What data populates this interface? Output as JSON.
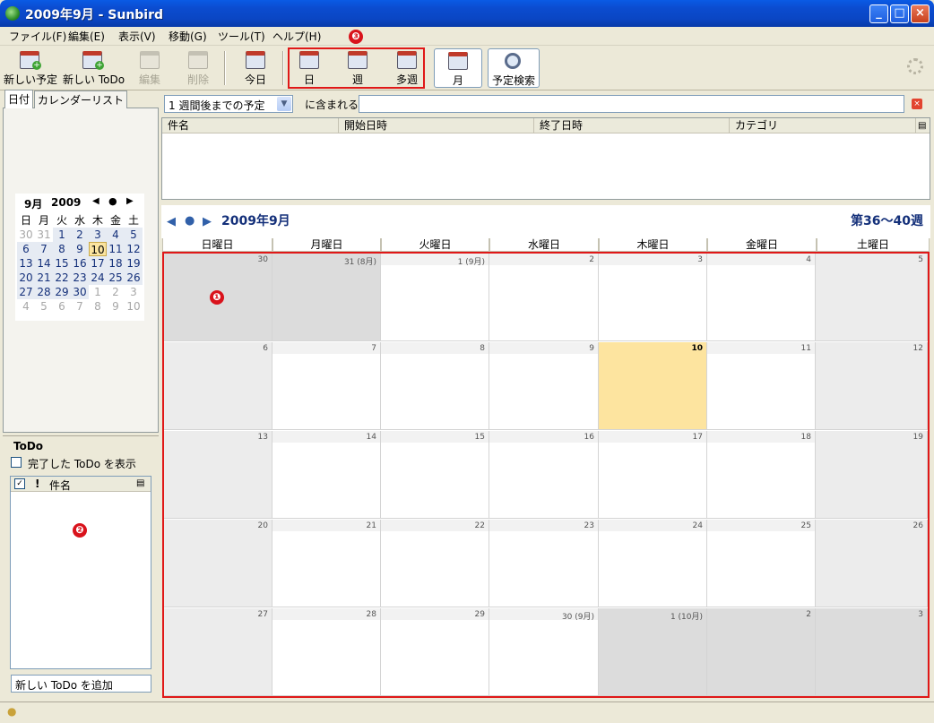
{
  "window": {
    "title": "2009年9月 - Sunbird"
  },
  "menu": [
    "ファイル(F)",
    "編集(E)",
    "表示(V)",
    "移動(G)",
    "ツール(T)",
    "ヘルプ(H)"
  ],
  "toolbar": {
    "new_event": "新しい予定",
    "new_todo": "新しい ToDo",
    "edit": "編集",
    "delete": "削除",
    "today": "今日",
    "day": "日",
    "week": "週",
    "multiweek": "多週",
    "month": "月",
    "search": "予定検索"
  },
  "left": {
    "tab_date": "日付",
    "tab_calendars": "カレンダーリスト",
    "minical": {
      "month": "9月",
      "year": "2009",
      "weekdays": [
        "日",
        "月",
        "火",
        "水",
        "木",
        "金",
        "土"
      ],
      "weeks": [
        [
          "30",
          "31",
          "1",
          "2",
          "3",
          "4",
          "5"
        ],
        [
          "6",
          "7",
          "8",
          "9",
          "10",
          "11",
          "12"
        ],
        [
          "13",
          "14",
          "15",
          "16",
          "17",
          "18",
          "19"
        ],
        [
          "20",
          "21",
          "22",
          "23",
          "24",
          "25",
          "26"
        ],
        [
          "27",
          "28",
          "29",
          "30",
          "1",
          "2",
          "3"
        ],
        [
          "4",
          "5",
          "6",
          "7",
          "8",
          "9",
          "10"
        ]
      ],
      "today": "10"
    },
    "todo": {
      "title": "ToDo",
      "show_completed": "完了した ToDo を表示",
      "col_name": "件名",
      "col_priority": "!",
      "add_placeholder": "新しい ToDo を追加"
    }
  },
  "filter": {
    "select_value": "1 週間後までの予定",
    "contains": "に含まれる"
  },
  "event_list": {
    "columns": [
      "件名",
      "開始日時",
      "終了日時",
      "カテゴリ"
    ]
  },
  "calendar": {
    "month_title": "2009年9月",
    "week_range": "第36〜40週",
    "day_names": [
      "日曜日",
      "月曜日",
      "火曜日",
      "水曜日",
      "木曜日",
      "金曜日",
      "土曜日"
    ],
    "weeks": [
      [
        "30",
        "31 (8月)",
        "1 (9月)",
        "2",
        "3",
        "4",
        "5"
      ],
      [
        "6",
        "7",
        "8",
        "9",
        "10",
        "11",
        "12"
      ],
      [
        "13",
        "14",
        "15",
        "16",
        "17",
        "18",
        "19"
      ],
      [
        "20",
        "21",
        "22",
        "23",
        "24",
        "25",
        "26"
      ],
      [
        "27",
        "28",
        "29",
        "30 (9月)",
        "1 (10月)",
        "2",
        "3"
      ]
    ],
    "today": "10"
  },
  "annotations": {
    "badge1": "❶",
    "badge2": "❷",
    "badge3": "❸"
  },
  "colors": {
    "highlight": "#e01818",
    "today": "#fde49f",
    "accent": "#14307a"
  }
}
